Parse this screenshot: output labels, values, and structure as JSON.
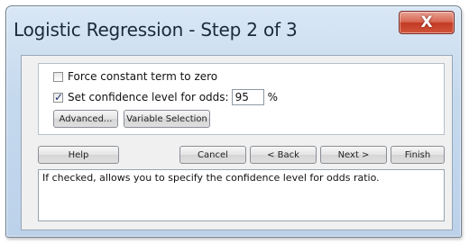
{
  "window": {
    "title": "Logistic Regression - Step 2 of 3",
    "close_label": "X"
  },
  "options": {
    "force_constant": {
      "label": "Force constant term to zero",
      "checked": false
    },
    "confidence": {
      "label": "Set confidence level for odds:",
      "checked": true,
      "value": "95",
      "unit": "%"
    }
  },
  "group_buttons": {
    "advanced": "Advanced...",
    "variable_selection": "Variable Selection"
  },
  "footer_buttons": {
    "help": "Help",
    "cancel": "Cancel",
    "back": "< Back",
    "next": "Next >",
    "finish": "Finish"
  },
  "status": {
    "text": "If checked, allows you to specify the confidence level for odds ratio."
  },
  "colors": {
    "frame": "#c5d9ee",
    "close": "#c23a22"
  }
}
